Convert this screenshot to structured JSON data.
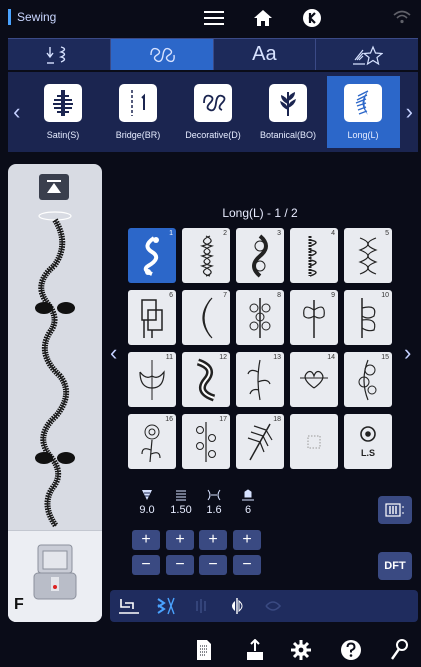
{
  "header": {
    "title": "Sewing"
  },
  "icons": {
    "menu": "menu-icon",
    "home": "home-icon",
    "back": "back-icon",
    "wifi": "wifi-icon"
  },
  "category_tabs": [
    {
      "name": "utility-stitch-tab",
      "glyph": "⟟"
    },
    {
      "name": "decorative-stitch-tab",
      "glyph": "∞"
    },
    {
      "name": "letters-tab",
      "glyph": "Aa"
    },
    {
      "name": "favorites-tab",
      "glyph": "☆"
    }
  ],
  "subcategories": [
    {
      "label": "Satin(S)"
    },
    {
      "label": "Bridge(BR)"
    },
    {
      "label": "Decorative(D)"
    },
    {
      "label": "Botanical(BO)"
    },
    {
      "label": "Long(L)"
    }
  ],
  "stitch_group_title": "Long(L) - 1 / 2",
  "stitches": [
    "1",
    "2",
    "3",
    "4",
    "5",
    "6",
    "7",
    "8",
    "9",
    "10",
    "11",
    "12",
    "13",
    "14",
    "15",
    "16",
    "17",
    "18",
    "",
    ""
  ],
  "special_cells": {
    "ls_label": "L.S"
  },
  "params": {
    "tension": "9.0",
    "length": "1.50",
    "width": "1.6",
    "presser": "6"
  },
  "buttons": {
    "plus": "+",
    "minus": "−",
    "dft": "DFT"
  },
  "preview": {
    "foot_letter": "F"
  },
  "colors": {
    "accent": "#2c67c9",
    "panel": "#1b2550",
    "bg": "#0a0c18"
  }
}
